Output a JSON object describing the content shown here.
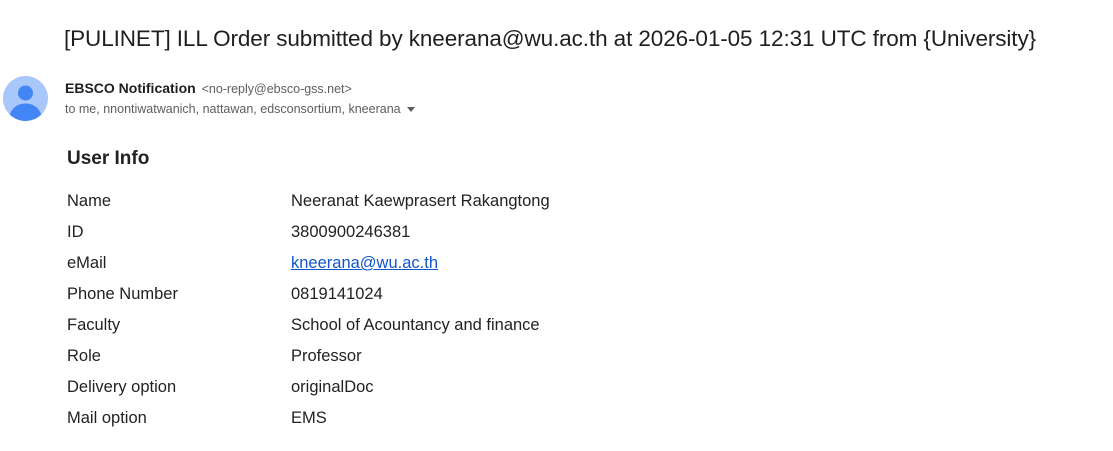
{
  "email": {
    "subject": "[PULINET] ILL Order submitted by kneerana@wu.ac.th at 2026-01-05 12:31 UTC from {University}",
    "sender": {
      "name": "EBSCO Notification",
      "address": "<no-reply@ebsco-gss.net>",
      "avatar_icon": "person-icon"
    },
    "recipients": "to me, nnontiwatwanich, nattawan, edsconsortium, kneerana"
  },
  "user_info": {
    "title": "User Info",
    "rows": [
      {
        "label": "Name",
        "value": "Neeranat Kaewprasert Rakangtong"
      },
      {
        "label": "ID",
        "value": "3800900246381"
      },
      {
        "label": "eMail",
        "value": "kneerana@wu.ac.th"
      },
      {
        "label": "Phone Number",
        "value": "0819141024"
      },
      {
        "label": "Faculty",
        "value": "School of Acountancy and finance"
      },
      {
        "label": "Role",
        "value": "Professor"
      },
      {
        "label": "Delivery option",
        "value": "originalDoc"
      },
      {
        "label": "Mail option",
        "value": "EMS"
      }
    ]
  },
  "colors": {
    "link": "#1155cc",
    "avatar_bg": "#a8c7fa",
    "avatar_fg": "#1a73e8"
  }
}
